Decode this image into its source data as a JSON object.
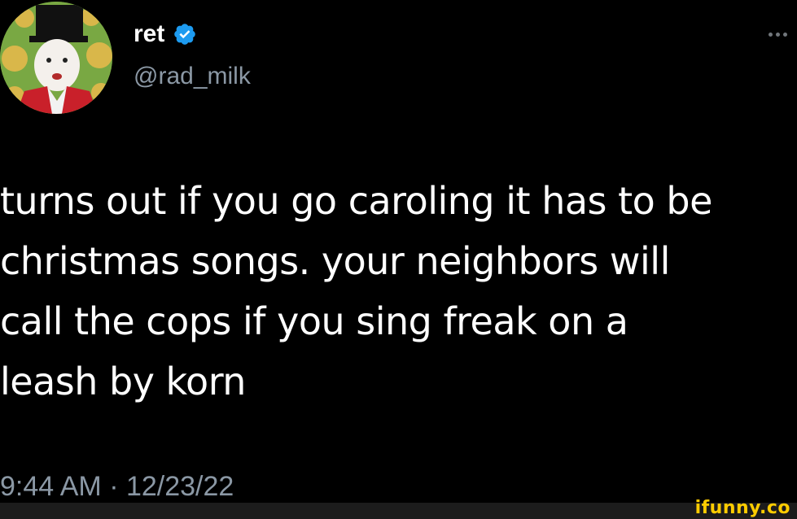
{
  "tweet": {
    "display_name": "ret",
    "handle": "@rad_milk",
    "verified": true,
    "text": "turns out if you go caroling it has to be\nchristmas songs. your neighbors will\ncall the cops if you sing freak on a\nleash by korn",
    "timestamp": "9:44 AM · 12/23/22"
  },
  "watermark": {
    "text": "ifunny.co"
  },
  "colors": {
    "background": "#000000",
    "text": "#ffffff",
    "secondary_text": "#8b98a5",
    "verified_badge": "#1d9bf0",
    "watermark": "#ffcc00"
  },
  "icons": {
    "verified": "verified-badge-icon",
    "more": "more-options-icon"
  }
}
